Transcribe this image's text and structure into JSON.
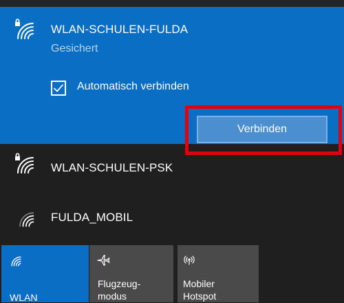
{
  "networks": [
    {
      "name": "WLAN-SCHULEN-FULDA",
      "status": "Gesichert",
      "secured": true,
      "selected": true,
      "auto_connect": {
        "label": "Automatisch verbinden",
        "checked": true
      },
      "connect_label": "Verbinden"
    },
    {
      "name": "WLAN-SCHULEN-PSK",
      "secured": true,
      "selected": false
    },
    {
      "name": "FULDA_MOBIL",
      "secured": false,
      "selected": false
    }
  ],
  "quick_actions": [
    {
      "line1": "",
      "line2": "WLAN",
      "icon": "wifi-icon",
      "active": true
    },
    {
      "line1": "Flugzeug-",
      "line2": "modus",
      "icon": "airplane-icon",
      "active": false
    },
    {
      "line1": "Mobiler",
      "line2": "Hotspot",
      "icon": "hotspot-icon",
      "active": false
    }
  ],
  "colors": {
    "selected_bg": "#0a6fc4",
    "panel_bg": "#1f1f1f",
    "highlight_border": "#e3000f",
    "button_bg": "#4b8fd1",
    "tile_active": "#0a6fc4",
    "tile_inactive": "#4a4a4a"
  }
}
